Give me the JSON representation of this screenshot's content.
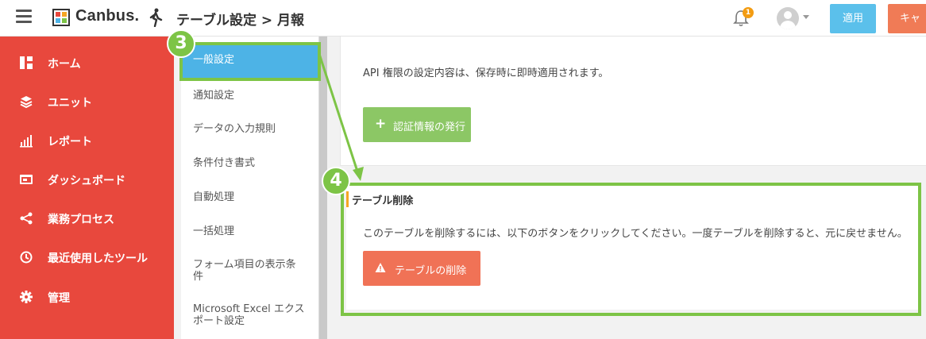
{
  "header": {
    "brand": "Canbus.",
    "title": "テーブル設定 > 月報",
    "notification_count": "1",
    "apply_label": "適用",
    "cancel_label": "キャ"
  },
  "sidebar": {
    "items": [
      {
        "label": "ホーム",
        "icon": "dashboard-grid-icon"
      },
      {
        "label": "ユニット",
        "icon": "layers-icon"
      },
      {
        "label": "レポート",
        "icon": "bar-chart-icon"
      },
      {
        "label": "ダッシュボード",
        "icon": "monitor-icon"
      },
      {
        "label": "業務プロセス",
        "icon": "process-share-icon"
      },
      {
        "label": "最近使用したツール",
        "icon": "history-clock-icon"
      },
      {
        "label": "管理",
        "icon": "gear-icon"
      }
    ]
  },
  "subnav": {
    "items": [
      {
        "label": "一般設定",
        "active": true
      },
      {
        "label": "通知設定"
      },
      {
        "label": "データの入力規則"
      },
      {
        "label": "条件付き書式"
      },
      {
        "label": "自動処理"
      },
      {
        "label": "一括処理"
      },
      {
        "label": "フォーム項目の表示条件",
        "line1": "フォーム項目の表示条",
        "line2": "件"
      },
      {
        "label": "Microsoft Excel エクスポート設定",
        "line1": "Microsoft Excel エクス",
        "line2": "ポート設定"
      }
    ]
  },
  "api_panel": {
    "description": "API 権限の設定内容は、保存時に即時適用されます。",
    "issue_button": "認証情報の発行"
  },
  "delete_panel": {
    "title": "テーブル削除",
    "description": "このテーブルを削除するには、以下のボタンをクリックしてください。一度テーブルを削除すると、元に戻せません。",
    "delete_button": "テーブルの削除"
  },
  "annotations": {
    "step3": "3",
    "step4": "4"
  },
  "colors": {
    "sidebar": "#e8483d",
    "active_tab": "#4db3e6",
    "apply": "#5bc0eb",
    "cancel": "#f07b56",
    "issue": "#8cc765",
    "delete": "#f07256",
    "annotation": "#7dc446"
  }
}
